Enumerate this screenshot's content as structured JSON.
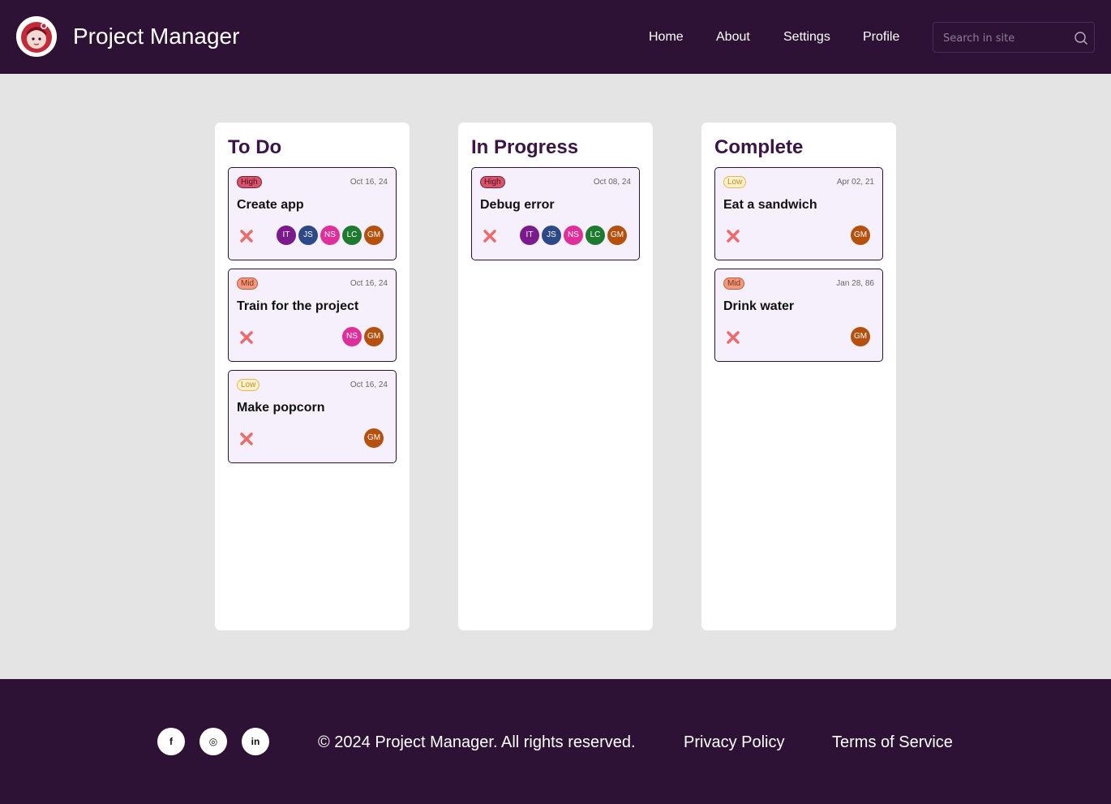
{
  "header": {
    "title": "Project Manager",
    "nav": [
      "Home",
      "About",
      "Settings",
      "Profile"
    ],
    "search_placeholder": "Search in site",
    "logo_icon": "avatar-logo-icon",
    "search_icon": "search-icon"
  },
  "columns": [
    {
      "title": "To Do",
      "cards": [
        {
          "priority": "High",
          "date": "Oct 16, 24",
          "title": "Create app",
          "assignees": [
            "IT",
            "JS",
            "NS",
            "LC",
            "GM"
          ]
        },
        {
          "priority": "Mid",
          "date": "Oct 16, 24",
          "title": "Train for the project",
          "assignees": [
            "NS",
            "GM"
          ]
        },
        {
          "priority": "Low",
          "date": "Oct 16, 24",
          "title": "Make popcorn",
          "assignees": [
            "GM"
          ]
        }
      ]
    },
    {
      "title": "In Progress",
      "cards": [
        {
          "priority": "High",
          "date": "Oct 08, 24",
          "title": "Debug error",
          "assignees": [
            "IT",
            "JS",
            "NS",
            "LC",
            "GM"
          ]
        }
      ]
    },
    {
      "title": "Complete",
      "cards": [
        {
          "priority": "Low",
          "date": "Apr 02, 21",
          "title": "Eat a sandwich",
          "assignees": [
            "GM"
          ]
        },
        {
          "priority": "Mid",
          "date": "Jan 28, 86",
          "title": "Drink water",
          "assignees": [
            "GM"
          ]
        }
      ]
    }
  ],
  "avatar_colors": {
    "IT": "#7b1a8a",
    "JS": "#2e4a86",
    "NS": "#de2f9b",
    "LC": "#1e7a2e",
    "GM": "#b5500d"
  },
  "colors": {
    "header_bg": "#2d1236",
    "page_bg": "#e4e4e4",
    "card_bg": "#f5f0fb",
    "delete_icon": "#ef6b6b"
  },
  "footer": {
    "social": [
      {
        "icon": "facebook-icon",
        "glyph": "f"
      },
      {
        "icon": "instagram-icon",
        "glyph": "◎"
      },
      {
        "icon": "linkedin-icon",
        "glyph": "in"
      }
    ],
    "copyright": "© 2024 Project Manager. All rights reserved.",
    "links": [
      "Privacy Policy",
      "Terms of Service"
    ]
  }
}
